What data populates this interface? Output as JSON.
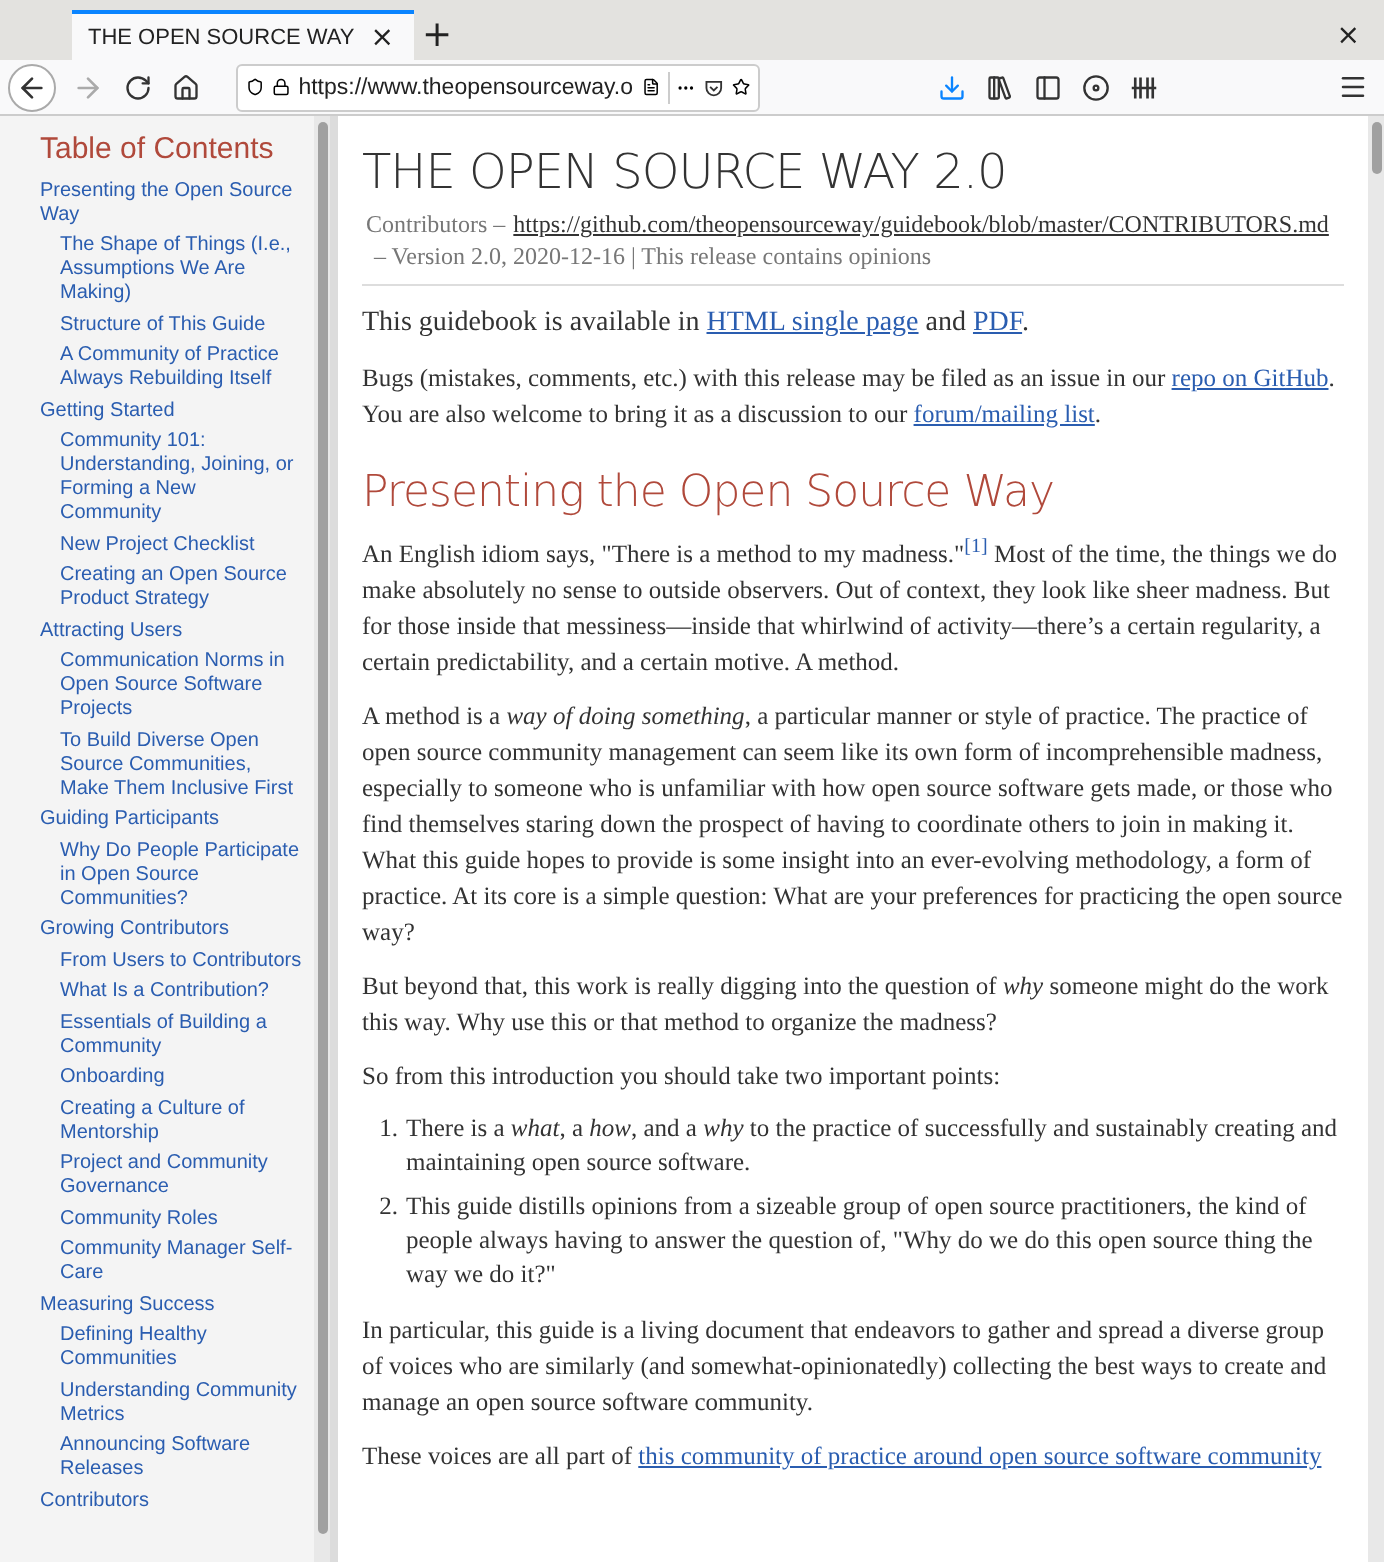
{
  "browser": {
    "tab_title": "THE OPEN SOURCE WAY",
    "tab_close": "×",
    "new_tab": "+",
    "window_close": "×",
    "url": "https://www.theopensourceway.o"
  },
  "toc": {
    "title": "Table of Contents",
    "items": [
      {
        "label": "Presenting the Open Source Way",
        "children": [
          {
            "label": "The Shape of Things (I.e., Assumptions We Are Making)"
          },
          {
            "label": "Structure of This Guide"
          },
          {
            "label": "A Community of Practice Always Rebuilding Itself"
          }
        ]
      },
      {
        "label": "Getting Started",
        "children": [
          {
            "label": "Community 101: Understanding, Joining, or Forming a New Community"
          },
          {
            "label": "New Project Checklist"
          },
          {
            "label": "Creating an Open Source Product Strategy"
          }
        ]
      },
      {
        "label": "Attracting Users",
        "children": [
          {
            "label": "Communication Norms in Open Source Software Projects"
          },
          {
            "label": "To Build Diverse Open Source Communities, Make Them Inclusive First"
          }
        ]
      },
      {
        "label": "Guiding Participants",
        "children": [
          {
            "label": "Why Do People Participate in Open Source Communities?"
          }
        ]
      },
      {
        "label": "Growing Contributors",
        "children": [
          {
            "label": "From Users to Contributors"
          },
          {
            "label": "What Is a Contribution?"
          },
          {
            "label": "Essentials of Building a Community"
          },
          {
            "label": "Onboarding"
          },
          {
            "label": "Creating a Culture of Mentorship"
          },
          {
            "label": "Project and Community Governance"
          },
          {
            "label": "Community Roles"
          },
          {
            "label": "Community Manager Self-Care"
          }
        ]
      },
      {
        "label": "Measuring Success",
        "children": [
          {
            "label": "Defining Healthy Communities"
          },
          {
            "label": "Understanding Community Metrics"
          },
          {
            "label": "Announcing Software Releases"
          }
        ]
      },
      {
        "label": "Contributors"
      }
    ]
  },
  "article": {
    "title": "THE OPEN SOURCE WAY 2.0",
    "byline_label": "Contributors –",
    "byline_link": "https://github.com/theopensourceway/guidebook/blob/master/CONTRIBUTORS.md",
    "version_line": "– Version 2.0, 2020-12-16 | This release contains opinions",
    "blocks": [
      {
        "kind": "lead",
        "parts": [
          {
            "kind": "text",
            "text": "This guidebook is available in "
          },
          {
            "kind": "link",
            "text": "HTML single page"
          },
          {
            "kind": "text",
            "text": " and "
          },
          {
            "kind": "link",
            "text": "PDF"
          },
          {
            "kind": "text",
            "text": "."
          }
        ]
      },
      {
        "kind": "para",
        "parts": [
          {
            "kind": "text",
            "text": "Bugs (mistakes, comments, etc.) with this release may be filed as an issue in our "
          },
          {
            "kind": "link",
            "text": "repo on GitHub"
          },
          {
            "kind": "text",
            "text": ". You are also welcome to bring it as a discussion to our "
          },
          {
            "kind": "link",
            "text": "forum/mailing list"
          },
          {
            "kind": "text",
            "text": "."
          }
        ]
      },
      {
        "kind": "heading",
        "text": "Presenting the Open Source Way"
      },
      {
        "kind": "para",
        "parts": [
          {
            "kind": "text",
            "text": "An English idiom says, \"There is a method to my madness.\""
          },
          {
            "kind": "footnote",
            "text": "[1]"
          },
          {
            "kind": "text",
            "text": " Most of the time, the things we do make absolutely no sense to outside observers. Out of context, they look like sheer madness. But for those inside that messiness—inside that whirlwind of activity—there’s a certain regularity, a certain predictability, and a certain motive. A method."
          }
        ]
      },
      {
        "kind": "para",
        "parts": [
          {
            "kind": "text",
            "text": "A method is a *way of doing something*, a particular manner or style of practice. The practice of open source community management can seem like its own form of incomprehensible madness, especially to someone who is unfamiliar with how open source software gets made, or those who find themselves staring down the prospect of having to coordinate others to join in making it. What this guide hopes to provide is some insight into an ever-evolving methodology, a form of practice. At its core is a simple question: What are your preferences for practicing the open source way?"
          }
        ]
      },
      {
        "kind": "para",
        "parts": [
          {
            "kind": "text",
            "text": "But beyond that, this work is really digging into the question of *why* someone might do the work this way. Why use this or that method to organize the madness?"
          }
        ]
      },
      {
        "kind": "para",
        "parts": [
          {
            "kind": "text",
            "text": "So from this introduction you should take two important points:"
          }
        ]
      },
      {
        "kind": "list",
        "items": [
          {
            "number": "1.",
            "text": "There is a *what*, a *how*, and a *why* to the practice of successfully and sustainably creating and maintaining open source software."
          },
          {
            "number": "2.",
            "text": "This guide distills opinions from a sizeable group of open source practitioners, the kind of people always having to answer the question of, \"Why do we do this open source thing the way we do it?\""
          }
        ]
      },
      {
        "kind": "para",
        "parts": [
          {
            "kind": "text",
            "text": "In particular, this guide is a living document that endeavors to gather and spread a diverse group of voices who are similarly (and somewhat-opinionatedly) collecting the best ways to create and manage an open source software community."
          }
        ]
      },
      {
        "kind": "para",
        "parts": [
          {
            "kind": "text",
            "text": "These voices are all part of "
          },
          {
            "kind": "link",
            "text": "this community of practice around open source software community"
          }
        ]
      }
    ]
  }
}
